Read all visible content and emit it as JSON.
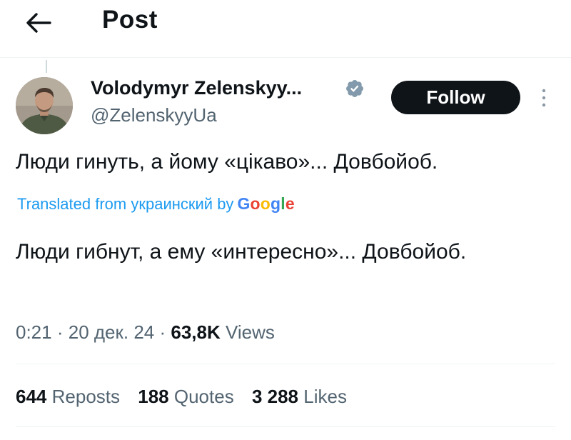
{
  "header": {
    "title": "Post",
    "back_icon": "arrow-left-icon"
  },
  "author": {
    "name": "Volodymyr Zelenskyy...",
    "handle": "@ZelenskyyUa",
    "verified_icon": "verified-badge-icon",
    "verified_color": "#1d9bf0"
  },
  "actions": {
    "follow_label": "Follow",
    "more_icon": "more-vertical-icon"
  },
  "post": {
    "text": "Люди гинуть, а йому «цікаво»... Довбойоб.",
    "translated_prefix": "Translated from украинский by",
    "translator": "Google",
    "translated_text": "Люди гибнут, а ему «интересно»... Довбойоб."
  },
  "meta": {
    "time": "0:21",
    "date": "20 дек. 24",
    "views_count": "63,8K",
    "views_label": "Views"
  },
  "stats": {
    "reposts_count": "644",
    "reposts_label": "Reposts",
    "quotes_count": "188",
    "quotes_label": "Quotes",
    "likes_count": "3 288",
    "likes_label": "Likes"
  },
  "colors": {
    "text": "#0f1419",
    "secondary": "#536471",
    "link": "#1d9bf0",
    "divider": "#eff3f4",
    "button_bg": "#0f1419"
  }
}
